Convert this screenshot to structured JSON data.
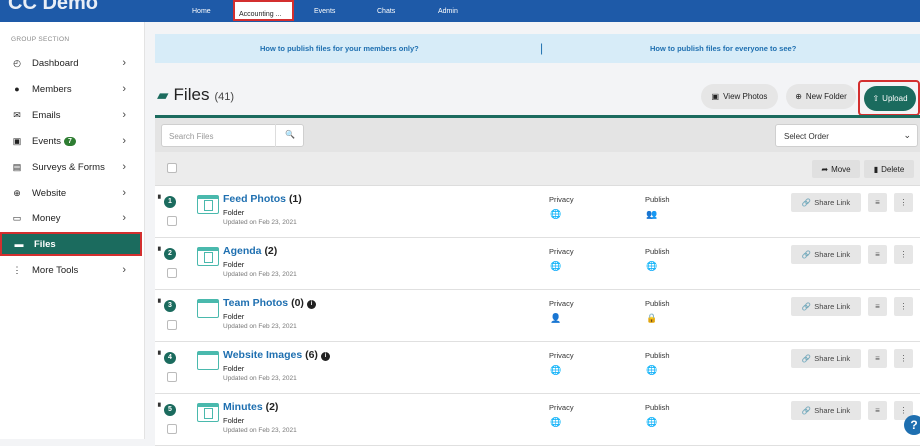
{
  "brand": "CC Demo",
  "nav": {
    "home": "Home",
    "accounting": "Accounting ...",
    "events": "Events",
    "chats": "Chats",
    "admin": "Admin"
  },
  "sidebar": {
    "group_label": "GROUP SECTION",
    "items": [
      {
        "label": "Dashboard",
        "icon": "dashboard-icon"
      },
      {
        "label": "Members",
        "icon": "person-icon"
      },
      {
        "label": "Emails",
        "icon": "envelope-icon"
      },
      {
        "label": "Events",
        "icon": "calendar-icon",
        "badge": "7"
      },
      {
        "label": "Surveys & Forms",
        "icon": "clipboard-icon"
      },
      {
        "label": "Website",
        "icon": "globe-icon"
      },
      {
        "label": "Money",
        "icon": "money-icon"
      },
      {
        "label": "Files",
        "icon": "folder-icon",
        "active": true
      },
      {
        "label": "More Tools",
        "icon": "more-icon"
      }
    ]
  },
  "banner": {
    "left": "How to publish files for your members only?",
    "right": "How to publish files for everyone to see?"
  },
  "header": {
    "title": "Files",
    "count": "(41)",
    "view_photos": "View Photos",
    "new_folder": "New Folder",
    "upload": "Upload"
  },
  "filter": {
    "search_placeholder": "Search Files",
    "order_value": "Select Order"
  },
  "actions": {
    "move": "Move",
    "delete": "Delete"
  },
  "columns": {
    "privacy": "Privacy",
    "publish": "Publish"
  },
  "rows": [
    {
      "num": "1",
      "name": "Feed Photos",
      "count": "(1)",
      "type": "Folder",
      "updated": "Updated on Feb 23, 2021",
      "privacy_icon": "globe-icon",
      "publish_icon": "group-icon",
      "share": "Share Link",
      "info": false
    },
    {
      "num": "2",
      "name": "Agenda",
      "count": "(2)",
      "type": "Folder",
      "updated": "Updated on Feb 23, 2021",
      "privacy_icon": "globe-icon",
      "publish_icon": "globe-icon",
      "share": "Share Link",
      "info": false
    },
    {
      "num": "3",
      "name": "Team Photos",
      "count": "(0)",
      "type": "Folder",
      "updated": "Updated on Feb 23, 2021",
      "privacy_icon": "members-icon",
      "publish_icon": "lock-icon",
      "share": "Share Link",
      "info": true
    },
    {
      "num": "4",
      "name": "Website Images",
      "count": "(6)",
      "type": "Folder",
      "updated": "Updated on Feb 23, 2021",
      "privacy_icon": "globe-icon",
      "publish_icon": "globe-icon",
      "share": "Share Link",
      "info": true
    },
    {
      "num": "5",
      "name": "Minutes",
      "count": "(2)",
      "type": "Folder",
      "updated": "Updated on Feb 23, 2021",
      "privacy_icon": "globe-icon",
      "publish_icon": "globe-icon",
      "share": "Share Link",
      "info": false
    }
  ]
}
